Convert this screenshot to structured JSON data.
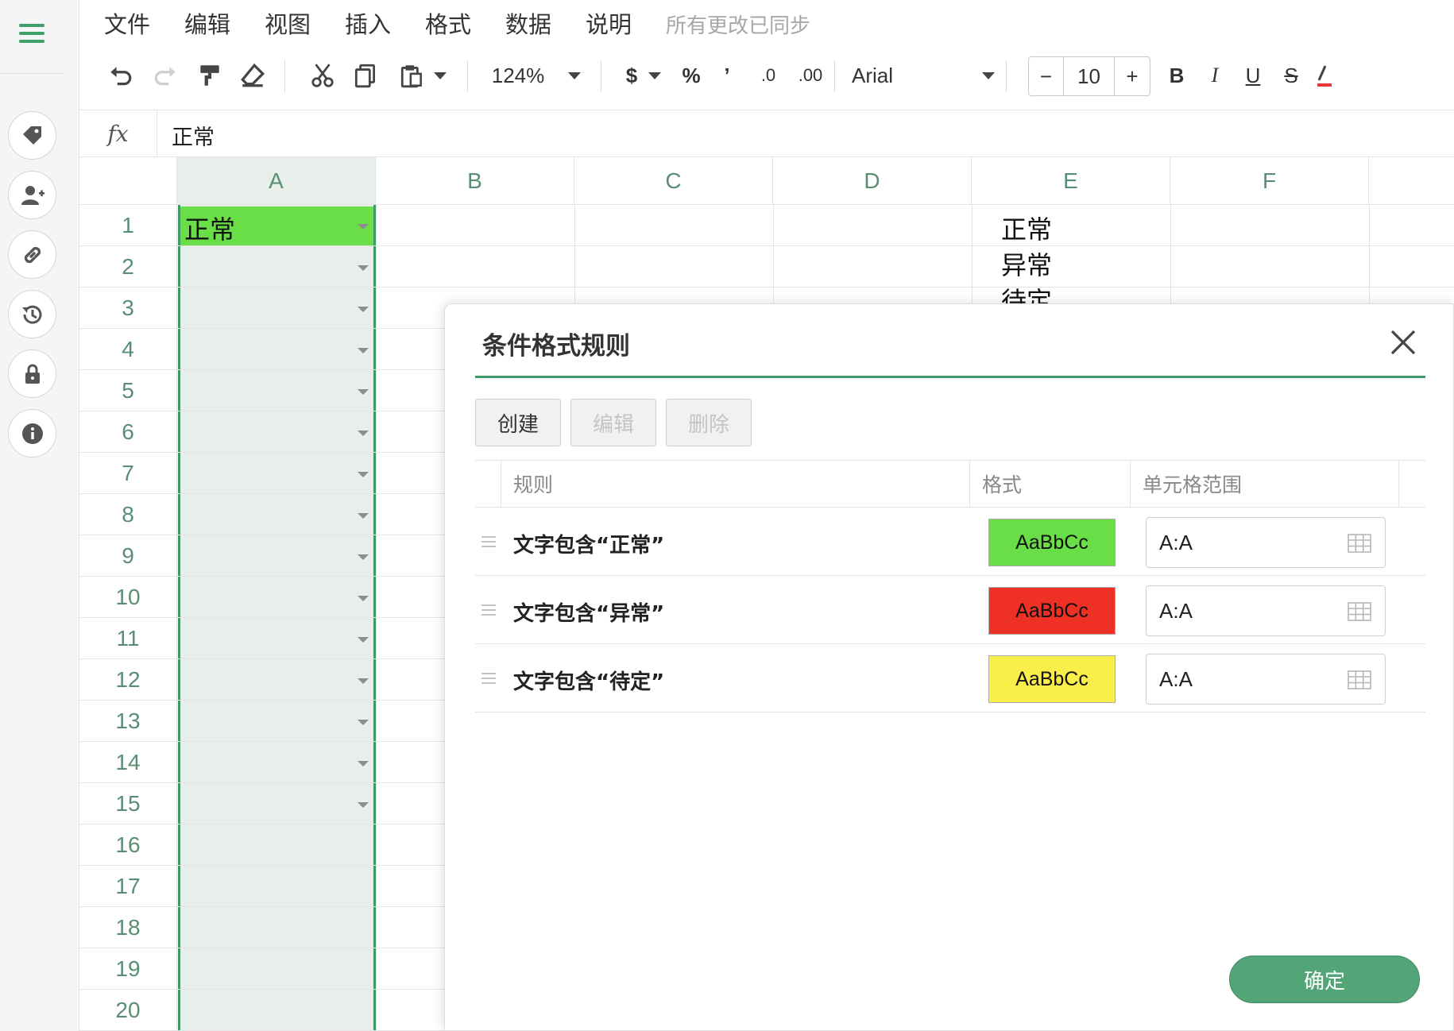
{
  "menu": [
    "文件",
    "编辑",
    "视图",
    "插入",
    "格式",
    "数据",
    "说明"
  ],
  "sync_status": "所有更改已同步",
  "toolbar": {
    "zoom": "124%",
    "currency": "$",
    "percent": "%",
    "comma": "’",
    "dec_dec": ".0",
    "dec_inc": ".00",
    "font": "Arial",
    "font_size": "10",
    "minus": "−",
    "plus": "+",
    "bold": "B",
    "italic": "I",
    "underline": "U",
    "strike": "S"
  },
  "formula": {
    "fx": "fx",
    "value": "正常"
  },
  "columns": [
    "A",
    "B",
    "C",
    "D",
    "E",
    "F"
  ],
  "rows": [
    "1",
    "2",
    "3",
    "4",
    "5",
    "6",
    "7",
    "8",
    "9",
    "10",
    "11",
    "12",
    "13",
    "14",
    "15",
    "16",
    "17",
    "18",
    "19",
    "20"
  ],
  "cells": {
    "A1": "正常",
    "E1": "正常",
    "E2": "异常",
    "E3": "待定"
  },
  "dialog": {
    "title": "条件格式规则",
    "buttons": {
      "create": "创建",
      "edit": "编辑",
      "delete": "删除"
    },
    "headers": {
      "rule": "规则",
      "format": "格式",
      "range": "单元格范围"
    },
    "rules": [
      {
        "text": "文字包含“正常”",
        "sample": "AaBbCc",
        "color": "#6ade47",
        "range": "A:A"
      },
      {
        "text": "文字包含“异常”",
        "sample": "AaBbCc",
        "color": "#ee3124",
        "range": "A:A"
      },
      {
        "text": "文字包含“待定”",
        "sample": "AaBbCc",
        "color": "#faee4a",
        "range": "A:A"
      }
    ],
    "confirm": "确定"
  },
  "colors": {
    "accent": "#3f9a68",
    "selection_fill": "#e8efeb"
  }
}
